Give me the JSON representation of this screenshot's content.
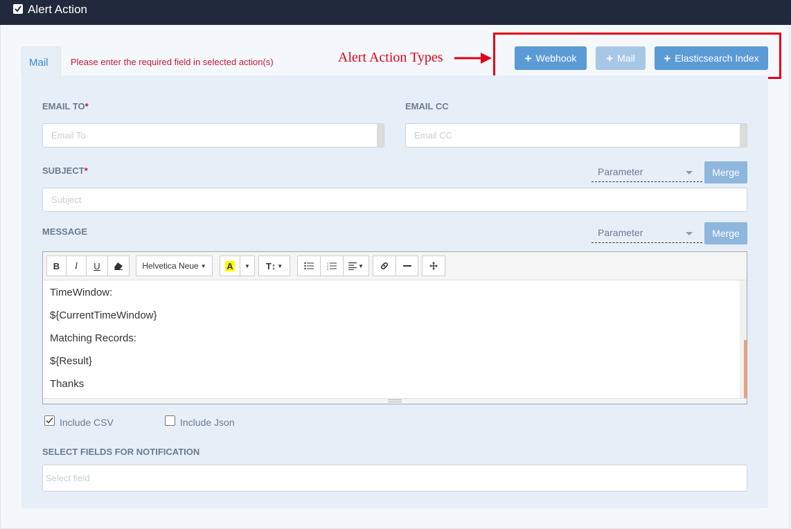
{
  "header": {
    "title": "Alert Action"
  },
  "tabs": [
    {
      "label": "Mail"
    }
  ],
  "required_message": "Please enter the required field in selected action(s)",
  "annotation": {
    "label": "Alert Action Types"
  },
  "action_buttons": [
    {
      "label": "Webhook",
      "enabled": true
    },
    {
      "label": "Mail",
      "enabled": false
    },
    {
      "label": "Elasticsearch Index",
      "enabled": true
    }
  ],
  "form": {
    "email_to": {
      "label": "EMAIL TO",
      "required_mark": "*",
      "placeholder": "Email To",
      "value": ""
    },
    "email_cc": {
      "label": "EMAIL CC",
      "placeholder": "Email CC",
      "value": ""
    },
    "subject": {
      "label": "SUBJECT",
      "required_mark": "*",
      "placeholder": "Subject",
      "value": "",
      "parameter_placeholder": "Parameter",
      "merge_label": "Merge"
    },
    "message": {
      "label": "MESSAGE",
      "parameter_placeholder": "Parameter",
      "merge_label": "Merge",
      "toolbar": {
        "bold": "B",
        "italic": "I",
        "underline": "U",
        "font_name": "Helvetica Neue",
        "font_color": "A",
        "font_size": "T↕"
      },
      "lines": [
        "TimeWindow:",
        "${CurrentTimeWindow}",
        "Matching Records:",
        "${Result}",
        "Thanks"
      ]
    },
    "include_csv": {
      "label": "Include CSV",
      "checked": true
    },
    "include_json": {
      "label": "Include Json",
      "checked": false
    },
    "select_fields": {
      "label": "SELECT FIELDS FOR NOTIFICATION",
      "placeholder": "Select field"
    }
  },
  "colors": {
    "header_bg": "#212a3c",
    "primary_button": "#5b9bd5",
    "required": "#c4163c",
    "annotation": "#e0001a"
  },
  "icons": [
    "checkbox-icon",
    "plus-icon",
    "arrow-right-icon",
    "eraser-icon",
    "list-ul-icon",
    "list-ol-icon",
    "align-icon",
    "link-icon",
    "hr-icon",
    "fullscreen-icon"
  ]
}
